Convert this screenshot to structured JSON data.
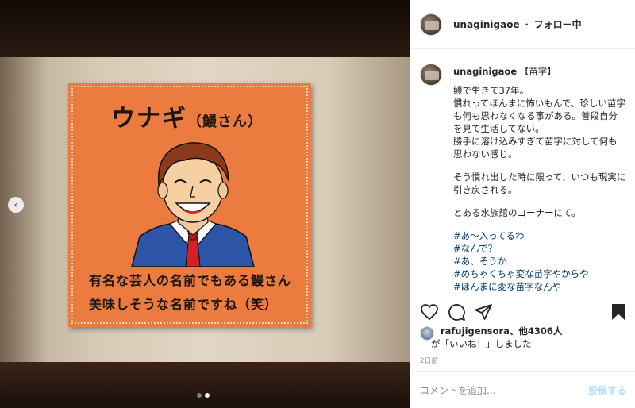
{
  "colors": {
    "link": "#00376b",
    "post_button": "#b2dffc",
    "poster_orange": "#ec7b3f",
    "muted": "#8e8e8e"
  },
  "photo": {
    "poster": {
      "title": "ウナギ",
      "title_sub": "（鰻さん）",
      "line1": "有名な芸人の名前でもある鰻さん",
      "line2": "美味しそうな名前ですね（笑）"
    },
    "carousel": {
      "prev_icon": "chevron-left-icon",
      "prev_glyph": "‹",
      "pages": 2,
      "current": 2
    }
  },
  "header": {
    "username": "unaginigaoe",
    "separator": "・",
    "follow_status": "フォロー中"
  },
  "caption": {
    "username": "unaginigaoe",
    "headline": "【苗字】",
    "paragraphs": [
      "鰻で生きて37年。\n慣れってほんまに怖いもんで、珍しい苗字も何も思わなくなる事がある。普段自分を見て生活してない。\n勝手に溶け込みすぎて苗字に対して何も思わない感じ。",
      "そう慣れ出した時に限って、いつも現実に引き戻される。",
      "とある水族館のコーナーにて。"
    ],
    "hashtags": [
      "#あ〜入ってるわ",
      "#なんで？",
      "#あ、そうか",
      "#めちゃくちゃ変な苗字やからや",
      "#ほんまに変な苗字なんや"
    ]
  },
  "actions": {
    "icons": [
      "heart-icon",
      "comment-icon",
      "share-icon",
      "bookmark-icon"
    ]
  },
  "likes": {
    "liker": "rafujigensora",
    "others_text": "、他4306人",
    "suffix": "が「いいね！」しました"
  },
  "timestamp": "2日前",
  "comment": {
    "placeholder": "コメントを追加...",
    "post_label": "投稿する"
  }
}
